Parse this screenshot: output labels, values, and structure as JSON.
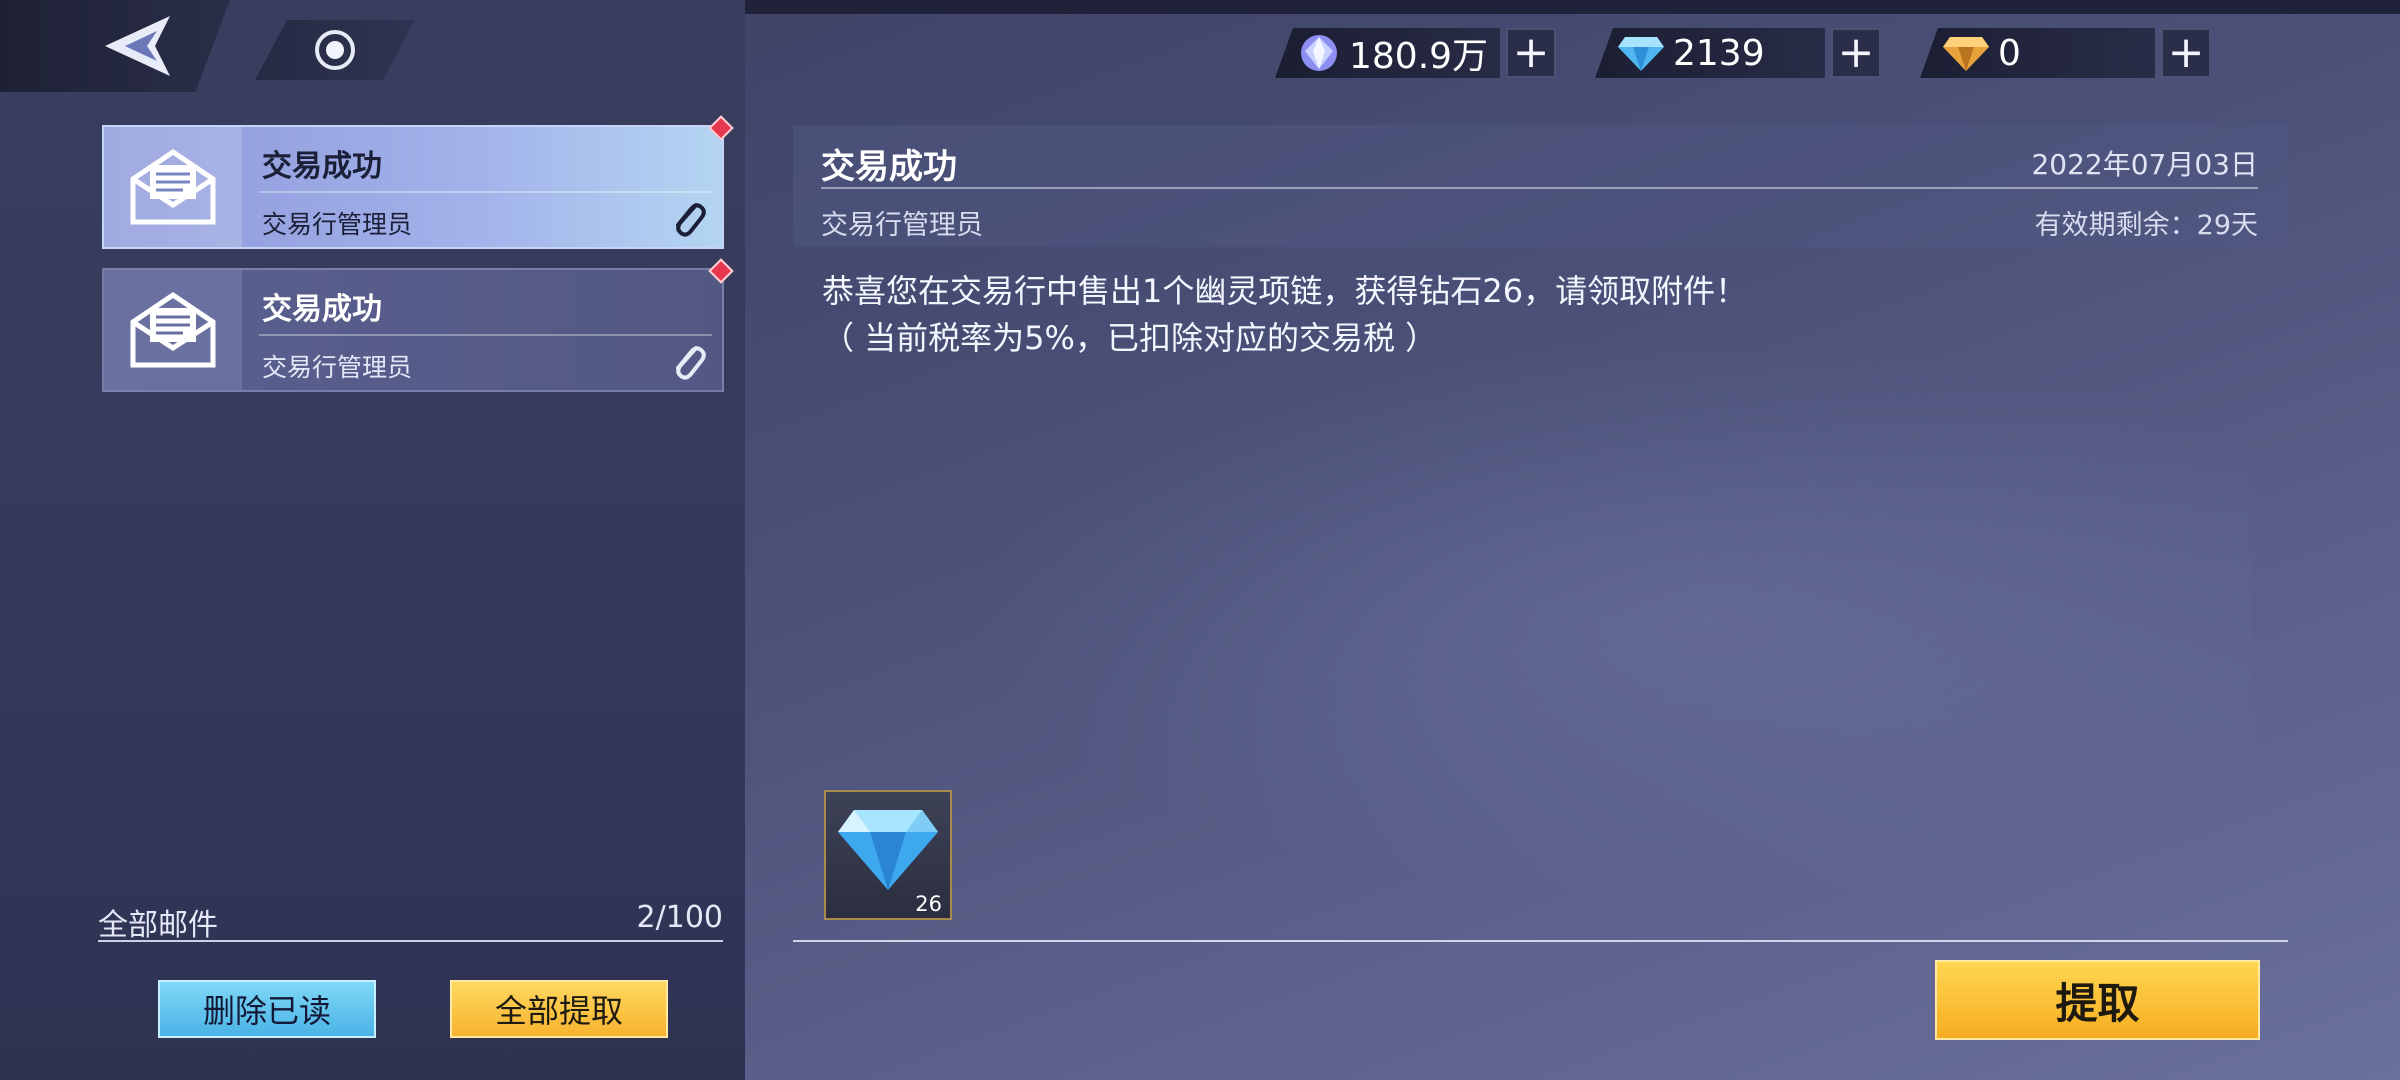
{
  "currencies": [
    {
      "amount": "180.9万",
      "icon": "crystal-orb-icon"
    },
    {
      "amount": "2139",
      "icon": "diamond-icon"
    },
    {
      "amount": "0",
      "icon": "gold-diamond-icon"
    }
  ],
  "mail_list": {
    "items": [
      {
        "title": "交易成功",
        "sender": "交易行管理员",
        "selected": true
      },
      {
        "title": "交易成功",
        "sender": "交易行管理员",
        "selected": false
      }
    ],
    "footer_label": "全部邮件",
    "footer_count": "2/100",
    "delete_read_label": "删除已读",
    "collect_all_label": "全部提取"
  },
  "detail": {
    "title": "交易成功",
    "date": "2022年07月03日",
    "sender": "交易行管理员",
    "expiry": "有效期剩余：29天",
    "body_line1": "恭喜您在交易行中售出1个幽灵项链，获得钻石26，请领取附件！",
    "body_line2": "（ 当前税率为5%，已扣除对应的交易税 ）",
    "attachment_qty": "26",
    "collect_label": "提取"
  }
}
